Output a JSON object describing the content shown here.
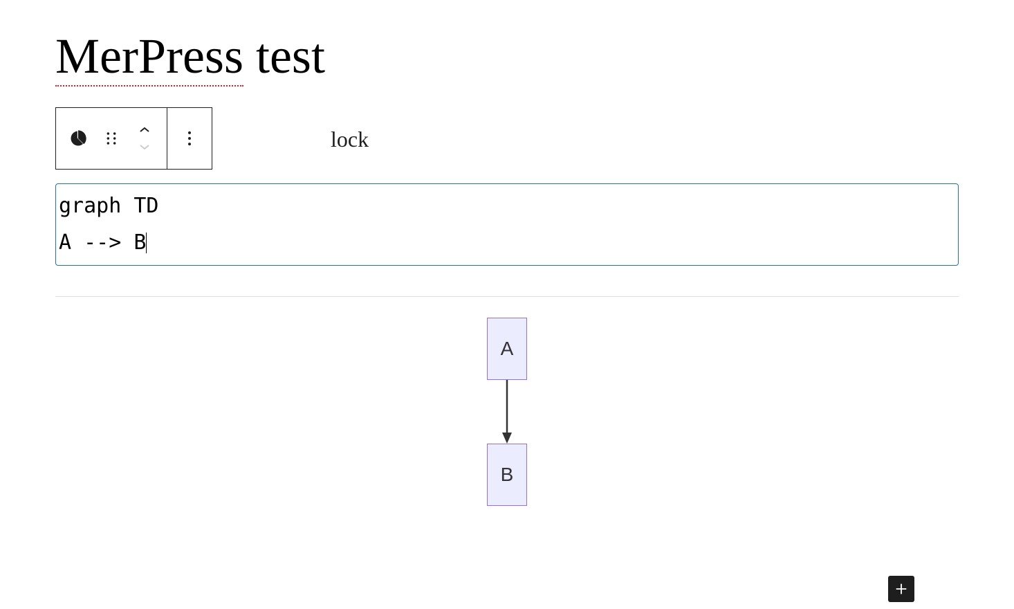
{
  "title": {
    "word1": "MerPress",
    "word2": " test"
  },
  "toolbar": {
    "behind_text": "lock",
    "block_name": "chart-block",
    "drag_name": "drag-handle",
    "move_up_name": "move-up",
    "move_down_name": "move-down",
    "options_name": "options",
    "pie_icon_alt": "block-icon"
  },
  "code": {
    "line1": "graph TD",
    "line2": "A --> B"
  },
  "code_full": "graph TD\nA --> B",
  "diagram": {
    "nodeA": "A",
    "nodeB": "B"
  },
  "add_button": {
    "label": "Add block"
  }
}
